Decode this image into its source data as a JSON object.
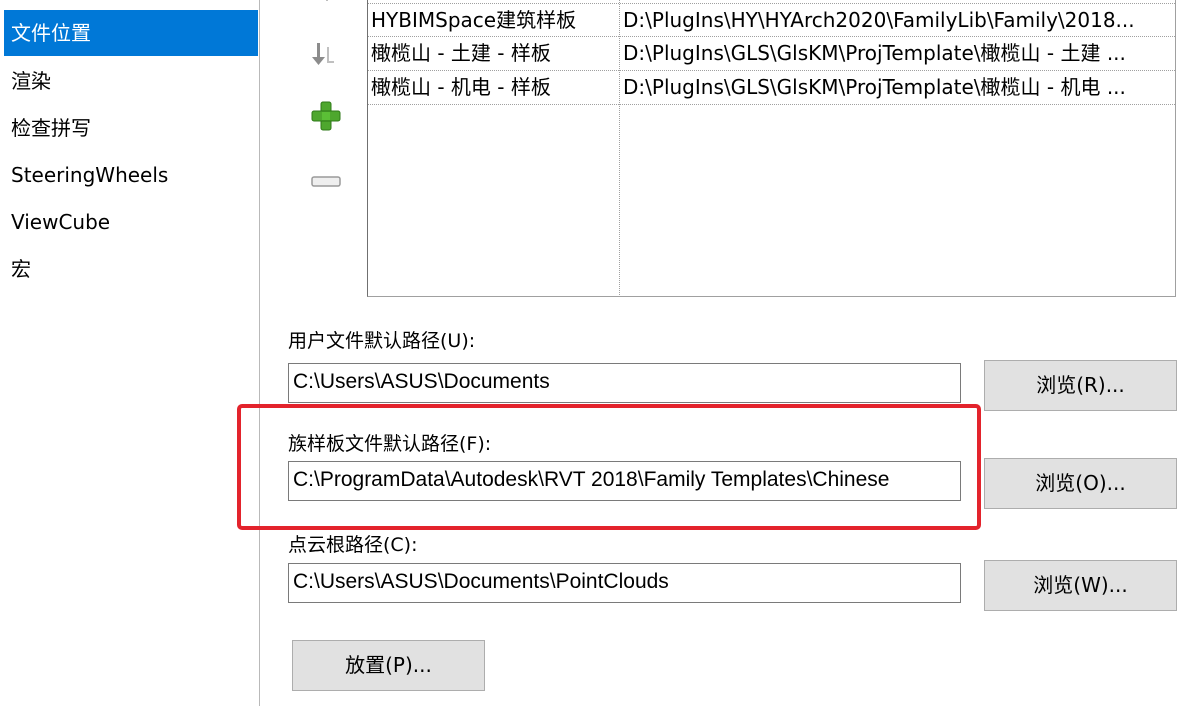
{
  "sidebar": {
    "items": [
      {
        "label": "文件位置",
        "active": true
      },
      {
        "label": "渲染"
      },
      {
        "label": "检查拼写"
      },
      {
        "label": "SteeringWheels"
      },
      {
        "label": "ViewCube"
      },
      {
        "label": "宏"
      }
    ]
  },
  "template_table": {
    "rows": [
      {
        "name": "HYBIMSpace建筑样板",
        "path": "D:\\PlugIns\\HY\\HYArch2020\\FamilyLib\\Family\\2018..."
      },
      {
        "name": "橄榄山 - 土建 - 样板",
        "path": "D:\\PlugIns\\GLS\\GlsKM\\ProjTemplate\\橄榄山 - 土建 ..."
      },
      {
        "name": "橄榄山 - 机电 - 样板",
        "path": "D:\\PlugIns\\GLS\\GlsKM\\ProjTemplate\\橄榄山 - 机电 ..."
      }
    ],
    "icons": [
      "move-down-icon",
      "add-icon",
      "remove-icon"
    ],
    "add_icon_color": "#4ea72e"
  },
  "user_files": {
    "label": "用户文件默认路径(U):",
    "value": "C:\\Users\\ASUS\\Documents",
    "browse_label": "浏览(R)..."
  },
  "family_templates": {
    "label": "族样板文件默认路径(F):",
    "value": "C:\\ProgramData\\Autodesk\\RVT 2018\\Family Templates\\Chinese",
    "browse_label": "浏览(O)..."
  },
  "point_cloud": {
    "label": "点云根路径(C):",
    "value": "C:\\Users\\ASUS\\Documents\\PointClouds",
    "browse_label": "浏览(W)..."
  },
  "places_button": {
    "label": "放置(P)..."
  },
  "colors": {
    "accent": "#0078d7",
    "highlight_border": "#e3232c"
  }
}
